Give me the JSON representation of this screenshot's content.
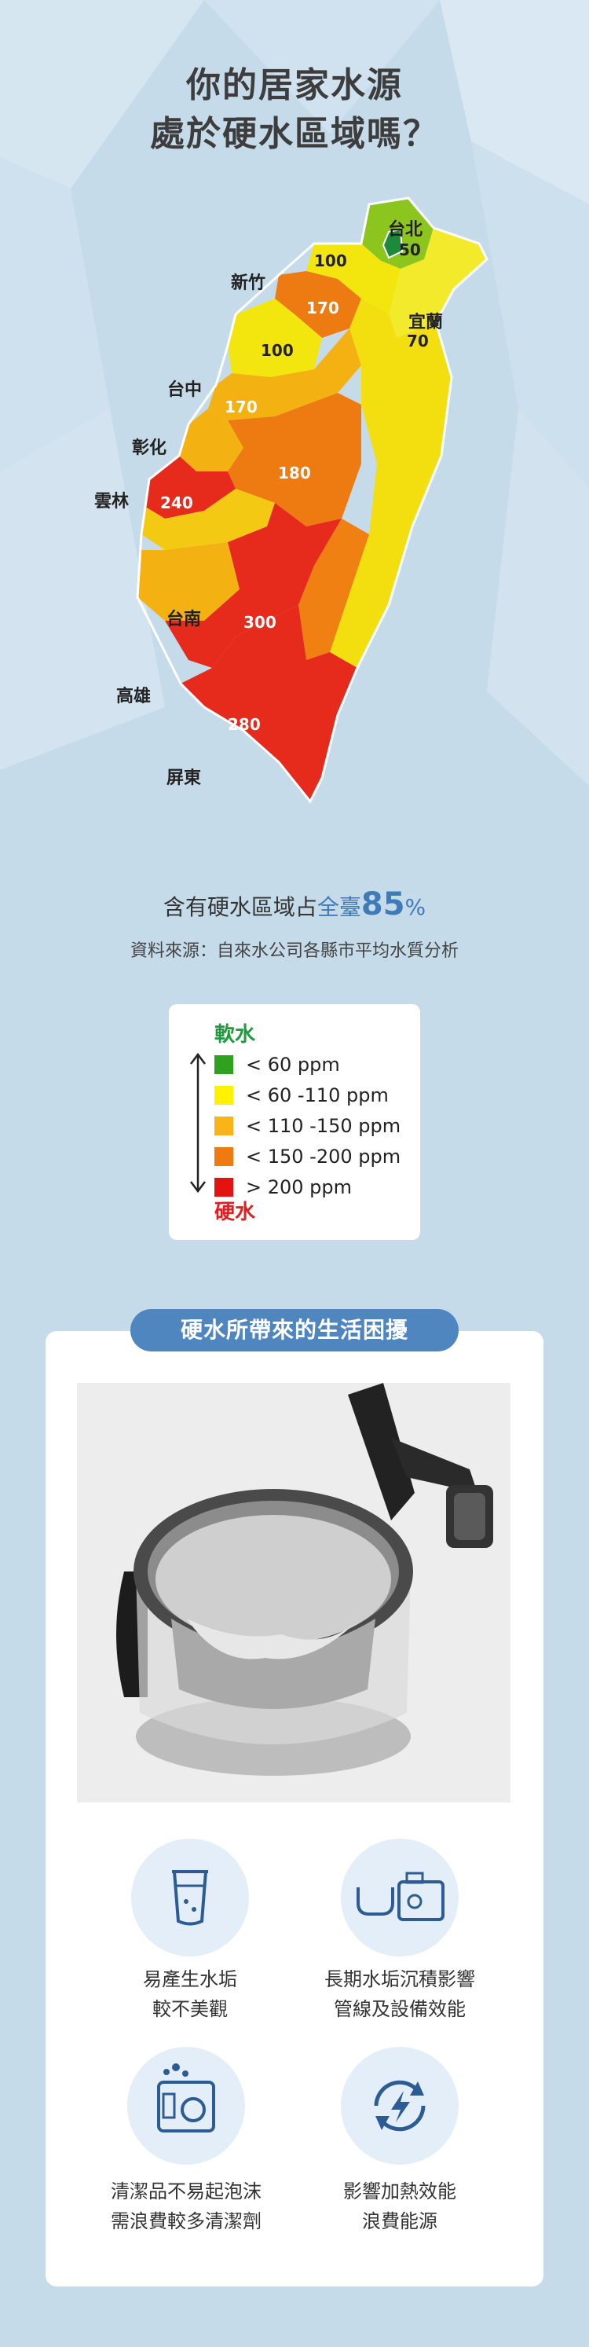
{
  "title": {
    "line1": "你的居家水源",
    "line2": "處於硬水區域嗎？"
  },
  "map": {
    "regions": {
      "taipei": {
        "label": "台北",
        "value": "50",
        "color": "#8cc51e"
      },
      "keelung": {
        "value": "100",
        "color": "#f3e60e"
      },
      "hsinchu": {
        "label": "新竹",
        "value": "170",
        "color": "#ee7a12"
      },
      "miaoli": {
        "value": "100",
        "color": "#f3e60e"
      },
      "yilan": {
        "label": "宜蘭",
        "value": "70",
        "color": "#f2ea2a"
      },
      "taichung": {
        "label": "台中",
        "value": "170",
        "color": "#f3b212"
      },
      "changhua": {
        "label": "彰化"
      },
      "nantou": {
        "value": "180",
        "color": "#ee7a12"
      },
      "yunlin": {
        "label": "雲林",
        "value": "240",
        "color": "#e62a1c"
      },
      "tainan": {
        "label": "台南"
      },
      "kaohsiung": {
        "label": "高雄",
        "value": "300",
        "color": "#e62a1c"
      },
      "pingtung": {
        "label": "屏東",
        "value": "280",
        "color": "#e62a1c"
      }
    }
  },
  "stat": {
    "prefix": "含有硬水區域占",
    "accent": "全臺",
    "percent": "85",
    "suffix": "%"
  },
  "source": "資料來源：自來水公司各縣市平均水質分析",
  "legend": {
    "soft_label": "軟水",
    "hard_label": "硬水",
    "items": [
      {
        "label": "< 60 ppm",
        "color": "#2ea11f"
      },
      {
        "label": "< 60 -110 ppm",
        "color": "#fff200"
      },
      {
        "label": "< 110 -150 ppm",
        "color": "#f7b51a"
      },
      {
        "label": "< 150 -200 ppm",
        "color": "#f07a12"
      },
      {
        "label": "> 200 ppm",
        "color": "#e3140f"
      }
    ]
  },
  "section": {
    "title": "硬水所帶來的生活困擾",
    "photo_icon": "glass-kettle-photo",
    "features": [
      {
        "icon": "cup-icon",
        "line1": "易產生水垢",
        "line2": "較不美觀"
      },
      {
        "icon": "pipes-icon",
        "line1": "長期水垢沉積影響",
        "line2": "管線及設備效能"
      },
      {
        "icon": "washing-machine-icon",
        "line1": "清潔品不易起泡沫",
        "line2": "需浪費較多清潔劑"
      },
      {
        "icon": "energy-cycle-icon",
        "line1": "影響加熱效能",
        "line2": "浪費能源"
      }
    ]
  }
}
